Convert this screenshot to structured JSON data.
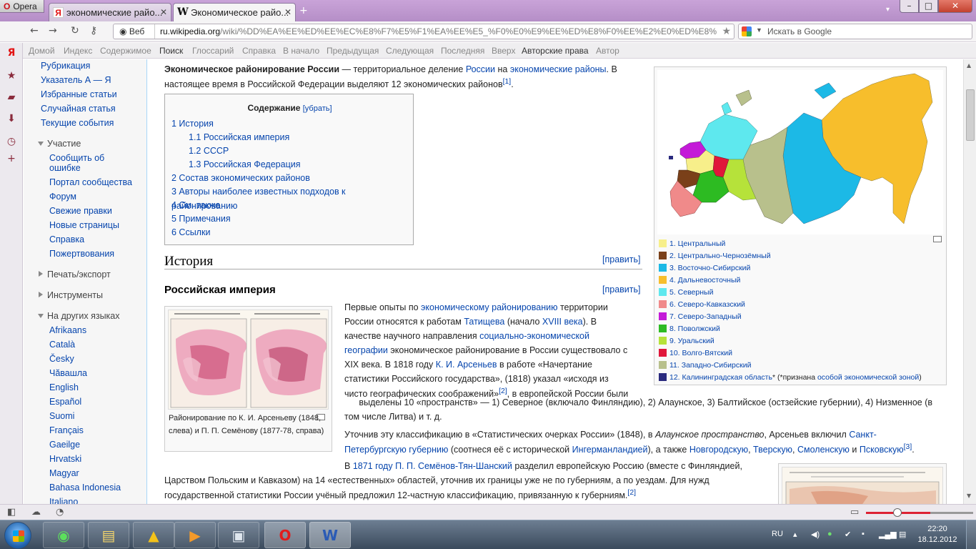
{
  "browser": {
    "menu_label": "Opera",
    "tabs": [
      {
        "label": "экономические райо...",
        "favicon": "Я"
      },
      {
        "label": "Экономическое райо...",
        "favicon": "W"
      }
    ],
    "address": {
      "site_label": "Веб",
      "domain": "ru.wikipedia.org",
      "path": "/wiki/%DD%EA%EE%ED%EE%EC%E8%F7%E5%F1%EA%EE%E5_%F0%E0%E9%EE%ED%E8%F0%EE%E2%E0%ED%E8%E5_%D0%EE%F1%F1%E8%E8"
    },
    "search_placeholder": "Искать в Google",
    "link_toolbar": [
      "Домой",
      "Индекс",
      "Содержимое",
      "Поиск",
      "Глоссарий",
      "Справка",
      "В начало",
      "Предыдущая",
      "Следующая",
      "Последняя",
      "Вверх",
      "Авторские права",
      "Автор"
    ]
  },
  "sidebar": {
    "top_links": [
      "Рубрикация",
      "Указатель А — Я",
      "Избранные статьи",
      "Случайная статья",
      "Текущие события"
    ],
    "participation_head": "Участие",
    "participation": [
      "Сообщить об",
      "ошибке",
      "Портал сообщества",
      "Форум",
      "Свежие правки",
      "Новые страницы",
      "Справка",
      "Пожертвования"
    ],
    "print_head": "Печать/экспорт",
    "tools_head": "Инструменты",
    "languages_head": "На других языках",
    "languages": [
      "Afrikaans",
      "Català",
      "Česky",
      "Чăвашла",
      "English",
      "Español",
      "Suomi",
      "Français",
      "Gaeilge",
      "Hrvatski",
      "Magyar",
      "Bahasa Indonesia",
      "Italiano"
    ]
  },
  "article": {
    "intro_bold": "Экономическое районирование России",
    "intro_1": " — территориальное деление ",
    "intro_link1": "России",
    "intro_2": " на ",
    "intro_link2": "экономические районы",
    "intro_3": ". В",
    "intro_line2": "настоящее время в Российской Федерации выделяют 12 экономических районов",
    "intro_ref": "[1]",
    "toc_title": "Содержание",
    "toc_hide": "[убрать]",
    "toc": [
      "1 История",
      "1.1 Российская империя",
      "1.2 СССР",
      "1.3 Российская Федерация",
      "2 Состав экономических районов",
      "3 Авторы наиболее известных подходов к районированию",
      "4 См. также",
      "5 Примечания",
      "6 Ссылки"
    ],
    "h2_history": "История",
    "edit_label": "[править]",
    "h3_empire": "Российская империя",
    "thumb_caption": "Районирование по К. И. Арсеньеву (1848, слева) и П. П. Семёнову (1877-78, справа)",
    "p1_lines": [
      "Первые опыты по экономическому районированию территории",
      "России относятся к работам Татищева (начало XVIII века). В",
      "качестве научного направления социально-экономической",
      "географии экономическое районирование в России существовало с",
      "XIX века. В 1818 году К. И. Арсеньев в работе «Начертание",
      "статистики Российского государства», (1818) указал «исходя из",
      "чисто географических соображений»[2], в европейской России были",
      "выделены 10 «пространств» — 1) Северное (включало Финляндию), 2) Алаунское, 3) Балтийское (остзейские губернии), 4) Низменное (в",
      "том числе Литва) и т. д."
    ],
    "p2_lines": [
      "Уточнив эту классификацию в «Статистических очерках России» (1848), в Алаунское пространство, Арсеньев включил Санкт-",
      "Петербургскую губернию (соотнеся её с исторической Ингерманландией), а также Новгородскую, Тверскую, Смоленскую и Псковскую[3]."
    ],
    "p3_lines": [
      "В 1871 году П. П. Семёнов-Тян-Шанский разделил европейскую Россию (вместе с Финляндией,",
      "Царством Польским и Кавказом) на 14 «естественных» областей, уточнив их границы уже не по губерниям, а по уездам. Для нужд",
      "государственной статистики России учёный предложил 12-частную классификацию, привязанную к губерниям.[2]"
    ]
  },
  "map_legend": [
    {
      "label": "1. Центральный",
      "color": "#f7ef8a"
    },
    {
      "label": "2. Центрально-Чернозёмный",
      "color": "#7a4019"
    },
    {
      "label": "3. Восточно-Сибирский",
      "color": "#1cb9e6"
    },
    {
      "label": "4. Дальневосточный",
      "color": "#f7be2c"
    },
    {
      "label": "5. Северный",
      "color": "#5ee8ee"
    },
    {
      "label": "6. Северо-Кавказский",
      "color": "#f08a8a"
    },
    {
      "label": "7. Северо-Западный",
      "color": "#c41ad8"
    },
    {
      "label": "8. Поволжский",
      "color": "#2dbb22"
    },
    {
      "label": "9. Уральский",
      "color": "#b6e23a"
    },
    {
      "label": "10. Волго-Вятский",
      "color": "#e0173a"
    },
    {
      "label": "11. Западно-Сибирский",
      "color": "#b8c08c"
    },
    {
      "label": "12. Калининградская область",
      "color": "#2a2a7e"
    }
  ],
  "legend_note_prefix": "(*признана ",
  "legend_note_link": "особой экономической зоной",
  "legend_note_suffix": ")",
  "taskbar": {
    "lang": "RU",
    "time": "22:20",
    "date": "18.12.2012"
  }
}
